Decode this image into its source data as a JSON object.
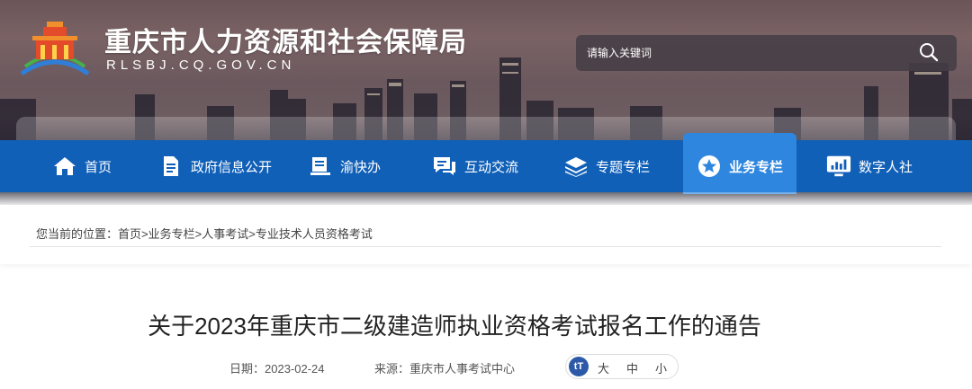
{
  "header": {
    "site_title": "重庆市人力资源和社会保障局",
    "site_domain": "RLSBJ.CQ.GOV.CN",
    "search": {
      "placeholder": "请输入关键词"
    }
  },
  "nav": {
    "items": [
      {
        "label": "首页",
        "icon": "home-icon"
      },
      {
        "label": "政府信息公开",
        "icon": "document-icon"
      },
      {
        "label": "渝快办",
        "icon": "book-icon"
      },
      {
        "label": "互动交流",
        "icon": "chat-icon"
      },
      {
        "label": "专题专栏",
        "icon": "layers-icon"
      },
      {
        "label": "业务专栏",
        "icon": "star-icon",
        "active": true
      },
      {
        "label": "数字人社",
        "icon": "monitor-chart-icon"
      }
    ]
  },
  "breadcrumb": {
    "prefix": "您当前的位置：",
    "items": [
      "首页",
      "业务专栏",
      "人事考试",
      "专业技术人员资格考试"
    ],
    "separator": ">"
  },
  "article": {
    "title": "关于2023年重庆市二级建造师执业资格考试报名工作的通告",
    "date_label": "日期：",
    "date": "2023-02-24",
    "source_label": "来源：",
    "source": "重庆市人事考试中心",
    "font_sizes": [
      "大",
      "中",
      "小"
    ]
  },
  "colors": {
    "nav_bg": "#1160b8",
    "nav_active": "#2e86de",
    "icon_badge": "#2d5aa8"
  }
}
